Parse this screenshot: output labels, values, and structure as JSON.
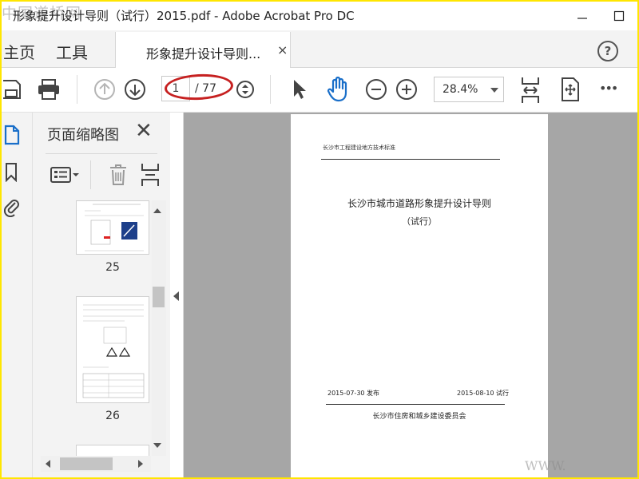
{
  "window": {
    "title": "形象提升设计导则（试行）2015.pdf - Adobe Acrobat Pro DC",
    "watermark_top": "中国道桥网",
    "watermark_bottom": "WWW."
  },
  "tabs": {
    "home": "主页",
    "tools": "工具",
    "document": "形象提升设计导则...",
    "close_symbol": "×",
    "help_symbol": "?"
  },
  "toolbar": {
    "current_page": "1",
    "page_total": "/ 77",
    "zoom": "28.4%",
    "more_symbol": "•••"
  },
  "panel": {
    "title": "页面缩略图",
    "close_symbol": "✕",
    "thumbnails": [
      {
        "page_number": "25"
      },
      {
        "page_number": "26"
      }
    ]
  },
  "document": {
    "header": "长沙市工程建设地方技术标准",
    "title": "长沙市城市道路形象提升设计导则",
    "subtitle": "（试行）",
    "issue_date": "2015-07-30   发布",
    "implement_date": "2015-08-10  试行",
    "issuer": "长沙市住房和城乡建设委员会"
  },
  "colors": {
    "frame_border": "#ffe600",
    "accent_blue": "#1a6fc9",
    "annotation_red": "#c62020",
    "canvas_gray": "#a6a6a6"
  }
}
